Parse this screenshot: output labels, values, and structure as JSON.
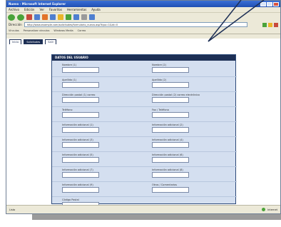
{
  "window": {
    "title": "Nuevo - Microsoft Internet Explorer"
  },
  "menu": {
    "items": [
      "Archivo",
      "Edición",
      "Ver",
      "Favoritos",
      "Herramientas",
      "Ayuda"
    ]
  },
  "address": {
    "label": "Dirección",
    "value": "http://www.example.com/solicitudes/formulario_nuevo.asp?tipo=1&id=0"
  },
  "links": {
    "items": [
      "Vínculos",
      "Personalizar vínculos",
      "Windows Media",
      "Correo"
    ]
  },
  "tabs": {
    "items": [
      "Inicio",
      "Solicitudes",
      "Salir"
    ]
  },
  "form": {
    "header": "DATOS DEL USUARIO",
    "fields": [
      {
        "label": "Nombre (1)",
        "value": ""
      },
      {
        "label": "Nombre (2)",
        "value": ""
      },
      {
        "label": "Apellido (1)",
        "value": ""
      },
      {
        "label": "Apellido (2)",
        "value": ""
      },
      {
        "label": "Dirección postal (1) correo",
        "value": ""
      },
      {
        "label": "Dirección postal (2) correo electrónico",
        "value": ""
      },
      {
        "label": "Teléfono",
        "value": ""
      },
      {
        "label": "Fax / Teléfono",
        "value": ""
      },
      {
        "label": "Información adicional (1)",
        "value": ""
      },
      {
        "label": "Información adicional (2)",
        "value": ""
      },
      {
        "label": "Información adicional (3)",
        "value": ""
      },
      {
        "label": "Información adicional (4)",
        "value": ""
      },
      {
        "label": "Información adicional (5)",
        "value": ""
      },
      {
        "label": "Información adicional (6)",
        "value": ""
      },
      {
        "label": "Información adicional (7)",
        "value": ""
      },
      {
        "label": "Información adicional (8)",
        "value": ""
      },
      {
        "label": "Información adicional (9)",
        "value": ""
      },
      {
        "label": "Otros / Comentarios",
        "value": ""
      },
      {
        "label": "Código Postal",
        "value": ""
      }
    ]
  },
  "status": {
    "left": "Listo",
    "right": "Internet"
  },
  "colors": {
    "navy": "#1d2f55",
    "panel": "#d4dff0",
    "chrome": "#ece9d8"
  }
}
